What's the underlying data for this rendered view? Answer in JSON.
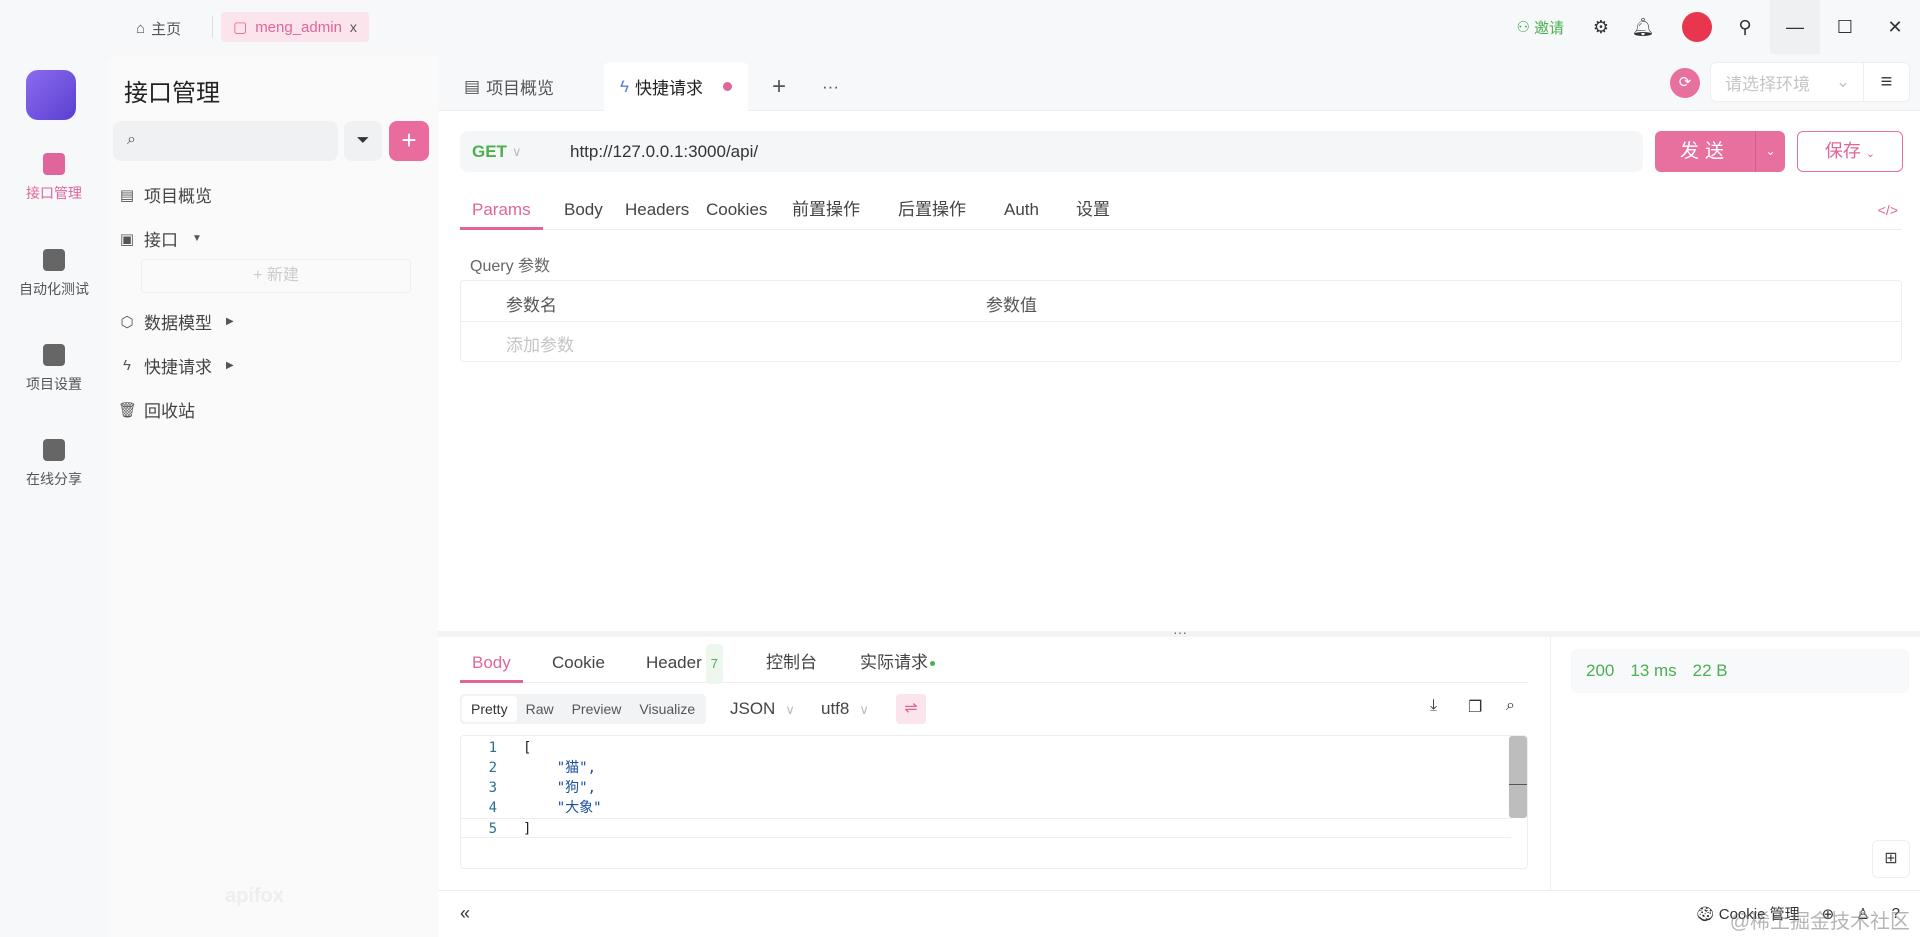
{
  "titlebar": {
    "home_label": "主页",
    "project_tab": "meng_admin",
    "close": "x",
    "invite": "邀请"
  },
  "rail": {
    "items": [
      {
        "label": "接口管理"
      },
      {
        "label": "自动化测试"
      },
      {
        "label": "项目设置"
      },
      {
        "label": "在线分享"
      }
    ]
  },
  "sidebar": {
    "title": "接口管理",
    "search_placeholder": "",
    "add": "+",
    "items": [
      {
        "label": "项目概览"
      },
      {
        "label": "接口"
      },
      {
        "label": "数据模型"
      },
      {
        "label": "快捷请求"
      },
      {
        "label": "回收站"
      }
    ],
    "new_label": "+ 新建",
    "watermark": "apifox"
  },
  "main": {
    "tabs": [
      {
        "label": "项目概览"
      },
      {
        "label": "快捷请求"
      }
    ],
    "add_tab": "+",
    "more": "···",
    "env_placeholder": "请选择环境"
  },
  "request": {
    "method": "GET",
    "url": "http://127.0.0.1:3000/api/",
    "send": "发送",
    "save": "保存",
    "tabs": [
      "Params",
      "Body",
      "Headers",
      "Cookies",
      "前置操作",
      "后置操作",
      "Auth",
      "设置"
    ],
    "query_label": "Query 参数",
    "col_name": "参数名",
    "col_value": "参数值",
    "add_param": "添加参数"
  },
  "response": {
    "tabs": [
      "Body",
      "Cookie",
      "Header",
      "控制台",
      "实际请求"
    ],
    "header_count": "7",
    "views": [
      "Pretty",
      "Raw",
      "Preview",
      "Visualize"
    ],
    "format": "JSON",
    "encoding": "utf8",
    "lines": [
      {
        "n": "1",
        "t": "["
      },
      {
        "n": "2",
        "t": "    \"猫\","
      },
      {
        "n": "3",
        "t": "    \"狗\","
      },
      {
        "n": "4",
        "t": "    \"大象\""
      },
      {
        "n": "5",
        "t": "]"
      }
    ],
    "status": "200",
    "time": "13 ms",
    "size": "22 B"
  },
  "statusbar": {
    "cookie": "Cookie 管理",
    "collapse": "«"
  },
  "watermark": "@稀土掘金技术社区",
  "colors": {
    "accent": "#e8709f",
    "success": "#4caf50"
  }
}
